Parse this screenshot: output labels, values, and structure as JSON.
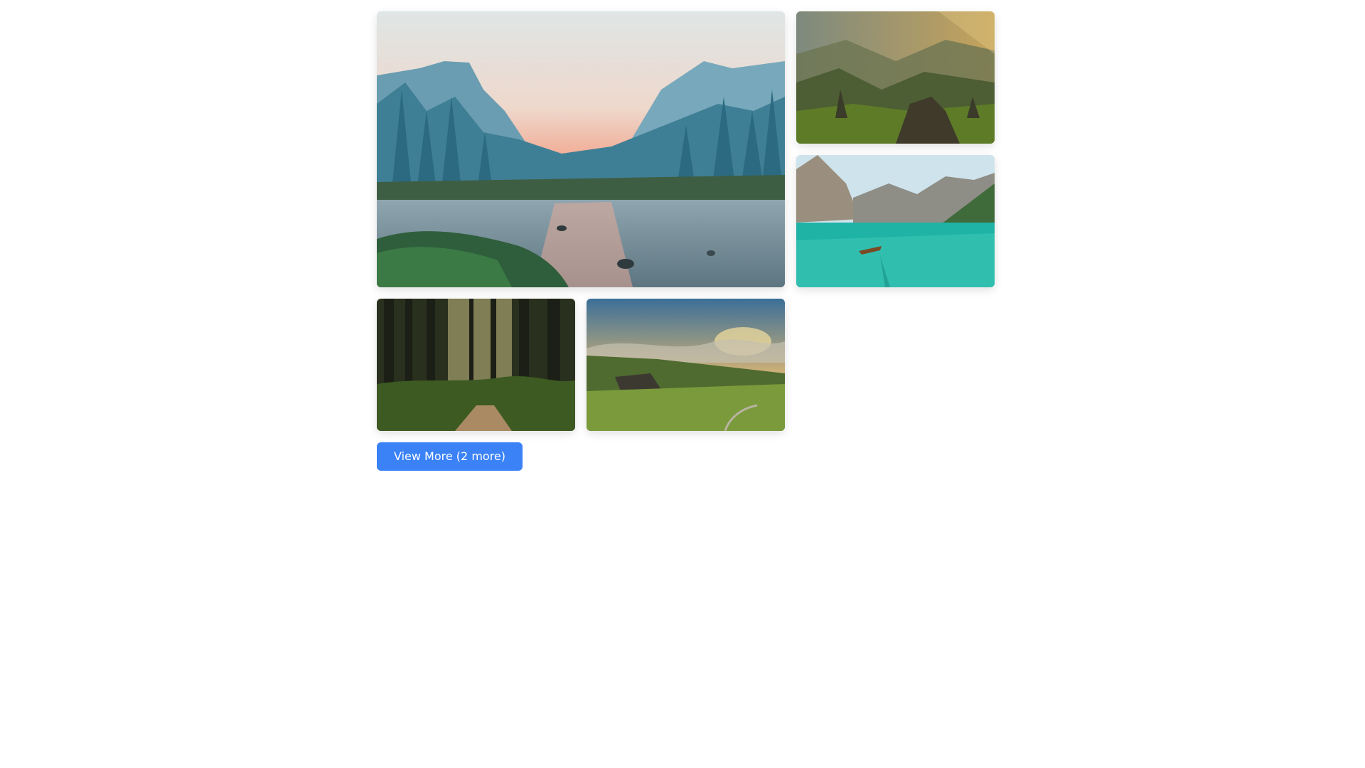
{
  "gallery": {
    "images": [
      {
        "subject": "misty-mountain-valley-river-photo"
      },
      {
        "subject": "golden-sunlit-mountain-peaks-photo"
      },
      {
        "subject": "turquoise-alpine-lake-boat-photo"
      },
      {
        "subject": "forest-path-tall-trees-photo"
      },
      {
        "subject": "green-hills-cloudy-sunset-photo"
      }
    ],
    "view_more_label": "View More (2 more)"
  },
  "colors": {
    "accent": "#3b82f6",
    "background": "#ffffff"
  }
}
